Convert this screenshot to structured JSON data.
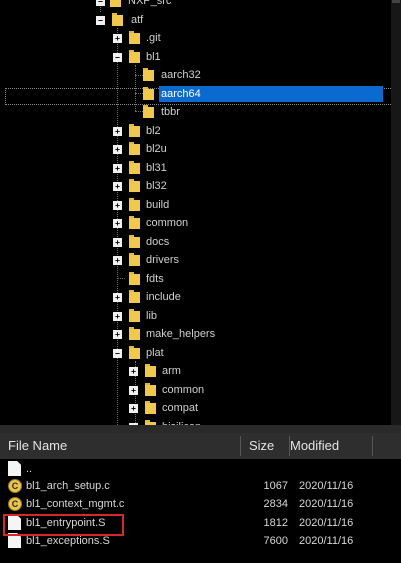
{
  "tree": {
    "nodes": [
      {
        "label": "NXP_src",
        "expander": "−"
      },
      {
        "label": "atf",
        "expander": "−"
      },
      {
        "label": ".git",
        "expander": "+"
      },
      {
        "label": "bl1",
        "expander": "−"
      },
      {
        "label": "aarch32",
        "expander": ""
      },
      {
        "label": "aarch64",
        "expander": ""
      },
      {
        "label": "tbbr",
        "expander": ""
      },
      {
        "label": "bl2",
        "expander": "+"
      },
      {
        "label": "bl2u",
        "expander": "+"
      },
      {
        "label": "bl31",
        "expander": "+"
      },
      {
        "label": "bl32",
        "expander": "+"
      },
      {
        "label": "build",
        "expander": "+"
      },
      {
        "label": "common",
        "expander": "+"
      },
      {
        "label": "docs",
        "expander": "+"
      },
      {
        "label": "drivers",
        "expander": "+"
      },
      {
        "label": "fdts",
        "expander": ""
      },
      {
        "label": "include",
        "expander": "+"
      },
      {
        "label": "lib",
        "expander": "+"
      },
      {
        "label": "make_helpers",
        "expander": "+"
      },
      {
        "label": "plat",
        "expander": "−"
      },
      {
        "label": "arm",
        "expander": "+"
      },
      {
        "label": "common",
        "expander": "+"
      },
      {
        "label": "compat",
        "expander": "+"
      },
      {
        "label": "hisilicon",
        "expander": "+"
      }
    ],
    "selected": "aarch64"
  },
  "file_list": {
    "headers": {
      "name": "File Name",
      "size": "Size",
      "modified": "Modified"
    },
    "rows": [
      {
        "name": "..",
        "size": "",
        "modified": "",
        "icon": "parent-folder-icon"
      },
      {
        "name": "bl1_arch_setup.c",
        "size": "1067",
        "modified": "2020/11/16",
        "icon": "c-file-icon"
      },
      {
        "name": "bl1_context_mgmt.c",
        "size": "2834",
        "modified": "2020/11/16",
        "icon": "c-file-icon"
      },
      {
        "name": "bl1_entrypoint.S",
        "size": "1812",
        "modified": "2020/11/16",
        "icon": "document-icon"
      },
      {
        "name": "bl1_exceptions.S",
        "size": "7600",
        "modified": "2020/11/16",
        "icon": "document-icon"
      }
    ],
    "highlighted": "bl1_entrypoint.S"
  },
  "colors": {
    "selection": "#0a6ad0",
    "highlight_box": "#d8262a",
    "folder": "#f2c84b"
  }
}
